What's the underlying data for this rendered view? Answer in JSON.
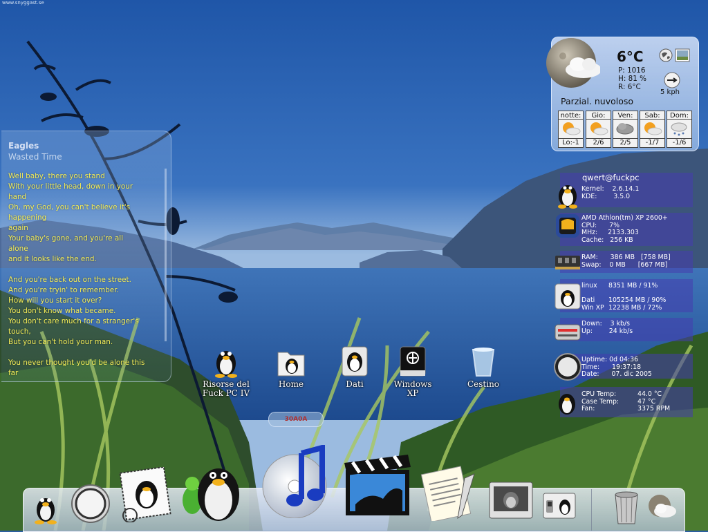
{
  "credit": "www.snyggast.se",
  "lyrics": {
    "artist": "Eagles",
    "song": "Wasted Time",
    "lines": [
      "Well baby, there you stand",
      "With your little head, down in your",
      "hand",
      "Oh, my God, you can't believe it's",
      "happening",
      "again",
      "Your baby's gone, and you're all",
      "alone",
      "and it looks like the end.",
      "",
      "And you're back out on the street.",
      "And you're tryin' to remember.",
      "How will you start it over?",
      "You don't know what became.",
      "You don't care much for a stranger's",
      "touch,",
      "But you can't hold your man.",
      "",
      "You never thought you'd be alone this",
      "far"
    ]
  },
  "weather": {
    "temp": "6°C",
    "pressure": "P: 1016",
    "humidity": "H: 81 %",
    "feels": "R: 6°C",
    "wind": "5 kph",
    "condition": "Parzial. nuvoloso",
    "forecast": [
      {
        "day": "notte:",
        "range": "Lo:-1",
        "icon": "sun-cloud-icon"
      },
      {
        "day": "Gio:",
        "range": "2/6",
        "icon": "sun-cloud-icon"
      },
      {
        "day": "Ven:",
        "range": "2/5",
        "icon": "cloud-icon"
      },
      {
        "day": "Sab:",
        "range": "-1/7",
        "icon": "sun-cloud-icon"
      },
      {
        "day": "Dom:",
        "range": "-1/6",
        "icon": "snow-cloud-icon"
      }
    ]
  },
  "system": {
    "user": "qwert@fuckpc",
    "os": "Kernel:    2.6.14.1\nKDE:        3.5.0",
    "cpu": "AMD Athlon(tm) XP 2600+\nCPU:      7%\nMHz:     2133.303\nCache:   256 KB",
    "mem": "RAM:      386 MB   [758 MB]\nSwap:    0 MB      [667 MB]",
    "disk_names": "linux\n\nDati\nWin XP",
    "disk_values": "8351 MB / 91%\n\n105254 MB / 90%\n12238 MB / 72%",
    "net": "Down:    3 kb/s\nUp:        24 kb/s",
    "time": "Uptime: 0d 04:36\nTime:      19:37:18\nDate:      07. dic 2005",
    "sensor_names": "CPU Temp:\nCase Temp:\nFan:",
    "sensor_values": "44.0 °C\n47 °C\n3375 RPM"
  },
  "desktop": {
    "icons": [
      {
        "label": "Risorse del\nFuck PC IV",
        "icon": "penguin-computer-icon"
      },
      {
        "label": "Home",
        "icon": "home-folder-icon"
      },
      {
        "label": "Dati",
        "icon": "drive-dati-icon"
      },
      {
        "label": "Windows\nXP",
        "icon": "drive-windows-icon"
      },
      {
        "label": "Cestino",
        "icon": "trash-can-icon"
      }
    ],
    "tag": "30A0A"
  },
  "dock": {
    "items": [
      "tux-icon",
      "safari-compass-icon",
      "stamp-mail-icon",
      "msn-messenger-icon",
      "tux-large-icon",
      "itunes-cd-icon",
      "film-clapper-icon",
      "text-editor-icon",
      "terminal-monitor-icon",
      "system-switch-icon",
      "trash-icon",
      "weather-cloud-icon"
    ]
  },
  "colors": {
    "lyrics_text": "#f3ec58",
    "panel_band": "#4c3caf",
    "sky": "#2c5f9f"
  }
}
